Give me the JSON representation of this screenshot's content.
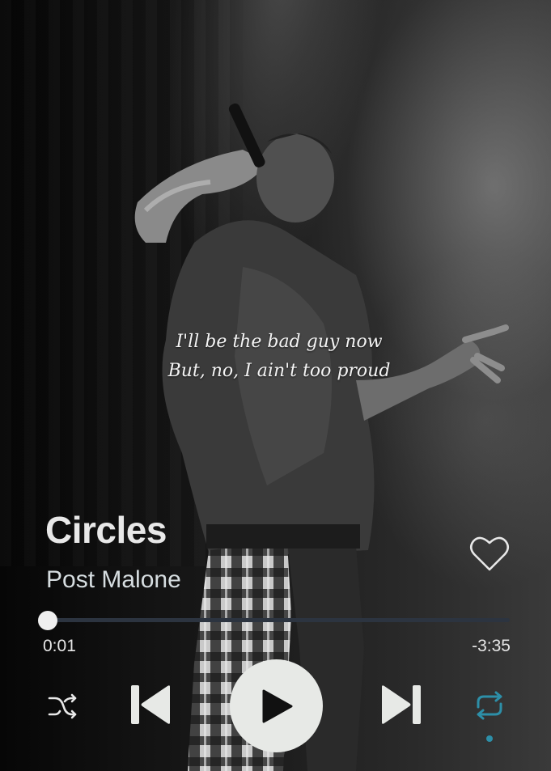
{
  "lyrics": {
    "line1": "I'll be the bad guy now",
    "line2": "But, no, I ain't too proud"
  },
  "song": {
    "title": "Circles",
    "artist": "Post Malone"
  },
  "progress": {
    "elapsed": "0:01",
    "remaining": "-3:35",
    "fraction": 0.005
  },
  "controls": {
    "shuffle_icon": "shuffle-icon",
    "previous_icon": "skip-previous-icon",
    "play_icon": "play-icon",
    "next_icon": "skip-next-icon",
    "repeat_icon": "repeat-icon",
    "favorite_icon": "heart-outline-icon",
    "repeat_active": true
  },
  "colors": {
    "accent": "#2d8fa8",
    "track": "#2c3440",
    "text": "#e8e8e8"
  }
}
